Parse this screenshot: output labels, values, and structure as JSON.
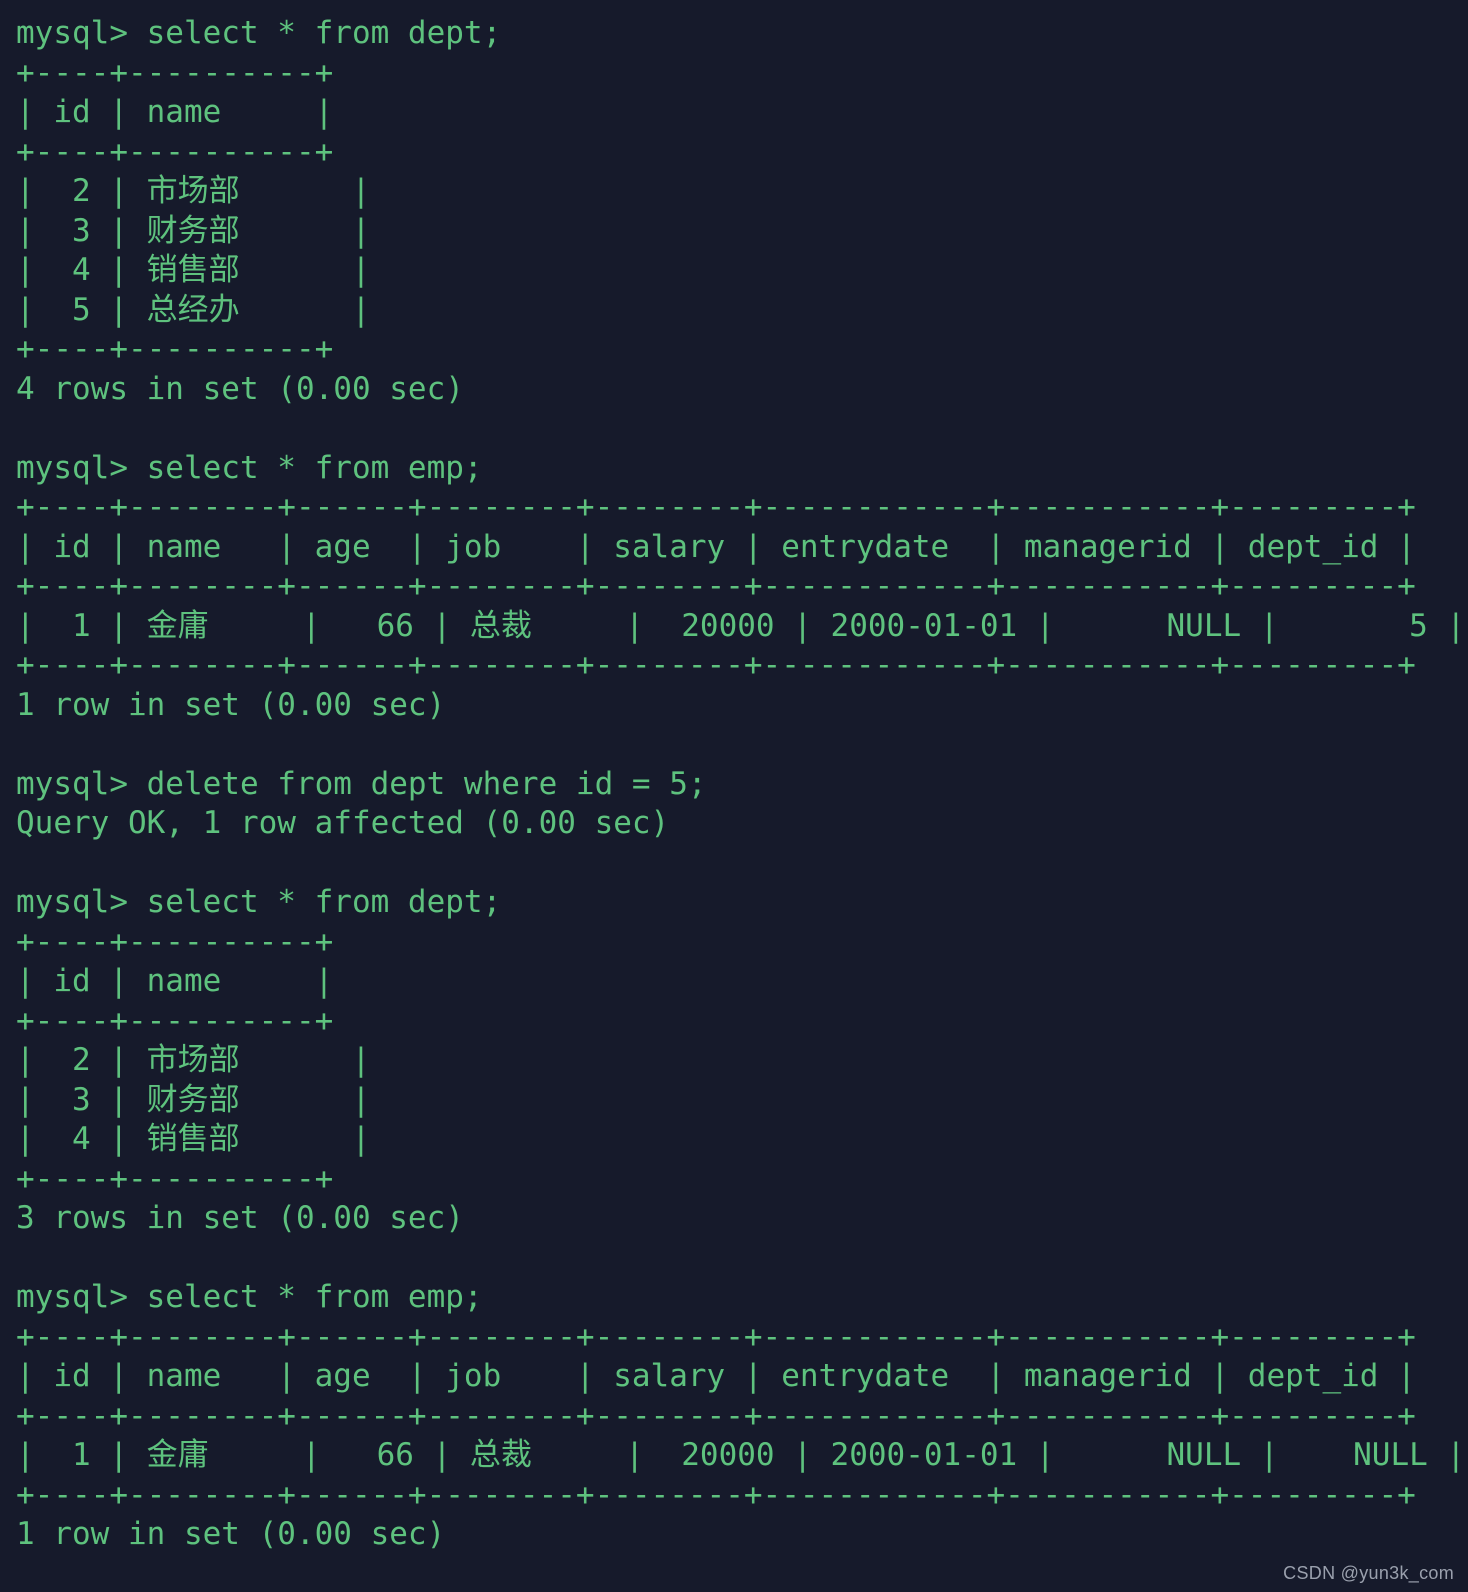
{
  "window": {
    "kind": "terminal",
    "background_color": "#161a2b",
    "text_color": "#5ec27e",
    "prompt": "mysql>"
  },
  "watermark": {
    "text": "CSDN @yun3k_com",
    "color": "#9aa0ad"
  },
  "session": {
    "blocks": [
      {
        "command": "mysql> select * from dept;",
        "table": {
          "separator": "+----+----------+",
          "header": "| id | name     |",
          "rows": [
            "|  2 | 市场部      |",
            "|  3 | 财务部      |",
            "|  4 | 销售部      |",
            "|  5 | 总经办      |"
          ]
        },
        "status": "4 rows in set (0.00 sec)"
      },
      {
        "command": "mysql> select * from emp;",
        "table": {
          "separator": "+----+--------+------+--------+--------+------------+-----------+---------+",
          "header": "| id | name   | age  | job    | salary | entrydate  | managerid | dept_id |",
          "rows": [
            "|  1 | 金庸     |   66 | 总裁     |  20000 | 2000-01-01 |      NULL |       5 |"
          ]
        },
        "status": "1 row in set (0.00 sec)"
      },
      {
        "command": "mysql> delete from dept where id = 5;",
        "table": null,
        "status": "Query OK, 1 row affected (0.00 sec)"
      },
      {
        "command": "mysql> select * from dept;",
        "table": {
          "separator": "+----+----------+",
          "header": "| id | name     |",
          "rows": [
            "|  2 | 市场部      |",
            "|  3 | 财务部      |",
            "|  4 | 销售部      |"
          ]
        },
        "status": "3 rows in set (0.00 sec)"
      },
      {
        "command": "mysql> select * from emp;",
        "table": {
          "separator": "+----+--------+------+--------+--------+------------+-----------+---------+",
          "header": "| id | name   | age  | job    | salary | entrydate  | managerid | dept_id |",
          "rows": [
            "|  1 | 金庸     |   66 | 总裁     |  20000 | 2000-01-01 |      NULL |    NULL |"
          ]
        },
        "status": "1 row in set (0.00 sec)"
      }
    ],
    "tables_data": {
      "dept_before": {
        "columns": [
          "id",
          "name"
        ],
        "rows": [
          [
            2,
            "市场部"
          ],
          [
            3,
            "财务部"
          ],
          [
            4,
            "销售部"
          ],
          [
            5,
            "总经办"
          ]
        ],
        "row_count": 4
      },
      "emp_before": {
        "columns": [
          "id",
          "name",
          "age",
          "job",
          "salary",
          "entrydate",
          "managerid",
          "dept_id"
        ],
        "rows": [
          [
            1,
            "金庸",
            66,
            "总裁",
            20000,
            "2000-01-01",
            "NULL",
            5
          ]
        ],
        "row_count": 1
      },
      "dept_after": {
        "columns": [
          "id",
          "name"
        ],
        "rows": [
          [
            2,
            "市场部"
          ],
          [
            3,
            "财务部"
          ],
          [
            4,
            "销售部"
          ]
        ],
        "row_count": 3
      },
      "emp_after": {
        "columns": [
          "id",
          "name",
          "age",
          "job",
          "salary",
          "entrydate",
          "managerid",
          "dept_id"
        ],
        "rows": [
          [
            1,
            "金庸",
            66,
            "总裁",
            20000,
            "2000-01-01",
            "NULL",
            "NULL"
          ]
        ],
        "row_count": 1
      }
    },
    "full_text": "mysql> select * from dept;\n+----+----------+\n| id | name     |\n+----+----------+\n|  2 | 市场部      |\n|  3 | 财务部      |\n|  4 | 销售部      |\n|  5 | 总经办      |\n+----+----------+\n4 rows in set (0.00 sec)\n\nmysql> select * from emp;\n+----+--------+------+--------+--------+------------+-----------+---------+\n| id | name   | age  | job    | salary | entrydate  | managerid | dept_id |\n+----+--------+------+--------+--------+------------+-----------+---------+\n|  1 | 金庸     |   66 | 总裁     |  20000 | 2000-01-01 |      NULL |       5 |\n+----+--------+------+--------+--------+------------+-----------+---------+\n1 row in set (0.00 sec)\n\nmysql> delete from dept where id = 5;\nQuery OK, 1 row affected (0.00 sec)\n\nmysql> select * from dept;\n+----+----------+\n| id | name     |\n+----+----------+\n|  2 | 市场部      |\n|  3 | 财务部      |\n|  4 | 销售部      |\n+----+----------+\n3 rows in set (0.00 sec)\n\nmysql> select * from emp;\n+----+--------+------+--------+--------+------------+-----------+---------+\n| id | name   | age  | job    | salary | entrydate  | managerid | dept_id |\n+----+--------+------+--------+--------+------------+-----------+---------+\n|  1 | 金庸     |   66 | 总裁     |  20000 | 2000-01-01 |      NULL |    NULL |\n+----+--------+------+--------+--------+------------+-----------+---------+\n1 row in set (0.00 sec)"
  }
}
